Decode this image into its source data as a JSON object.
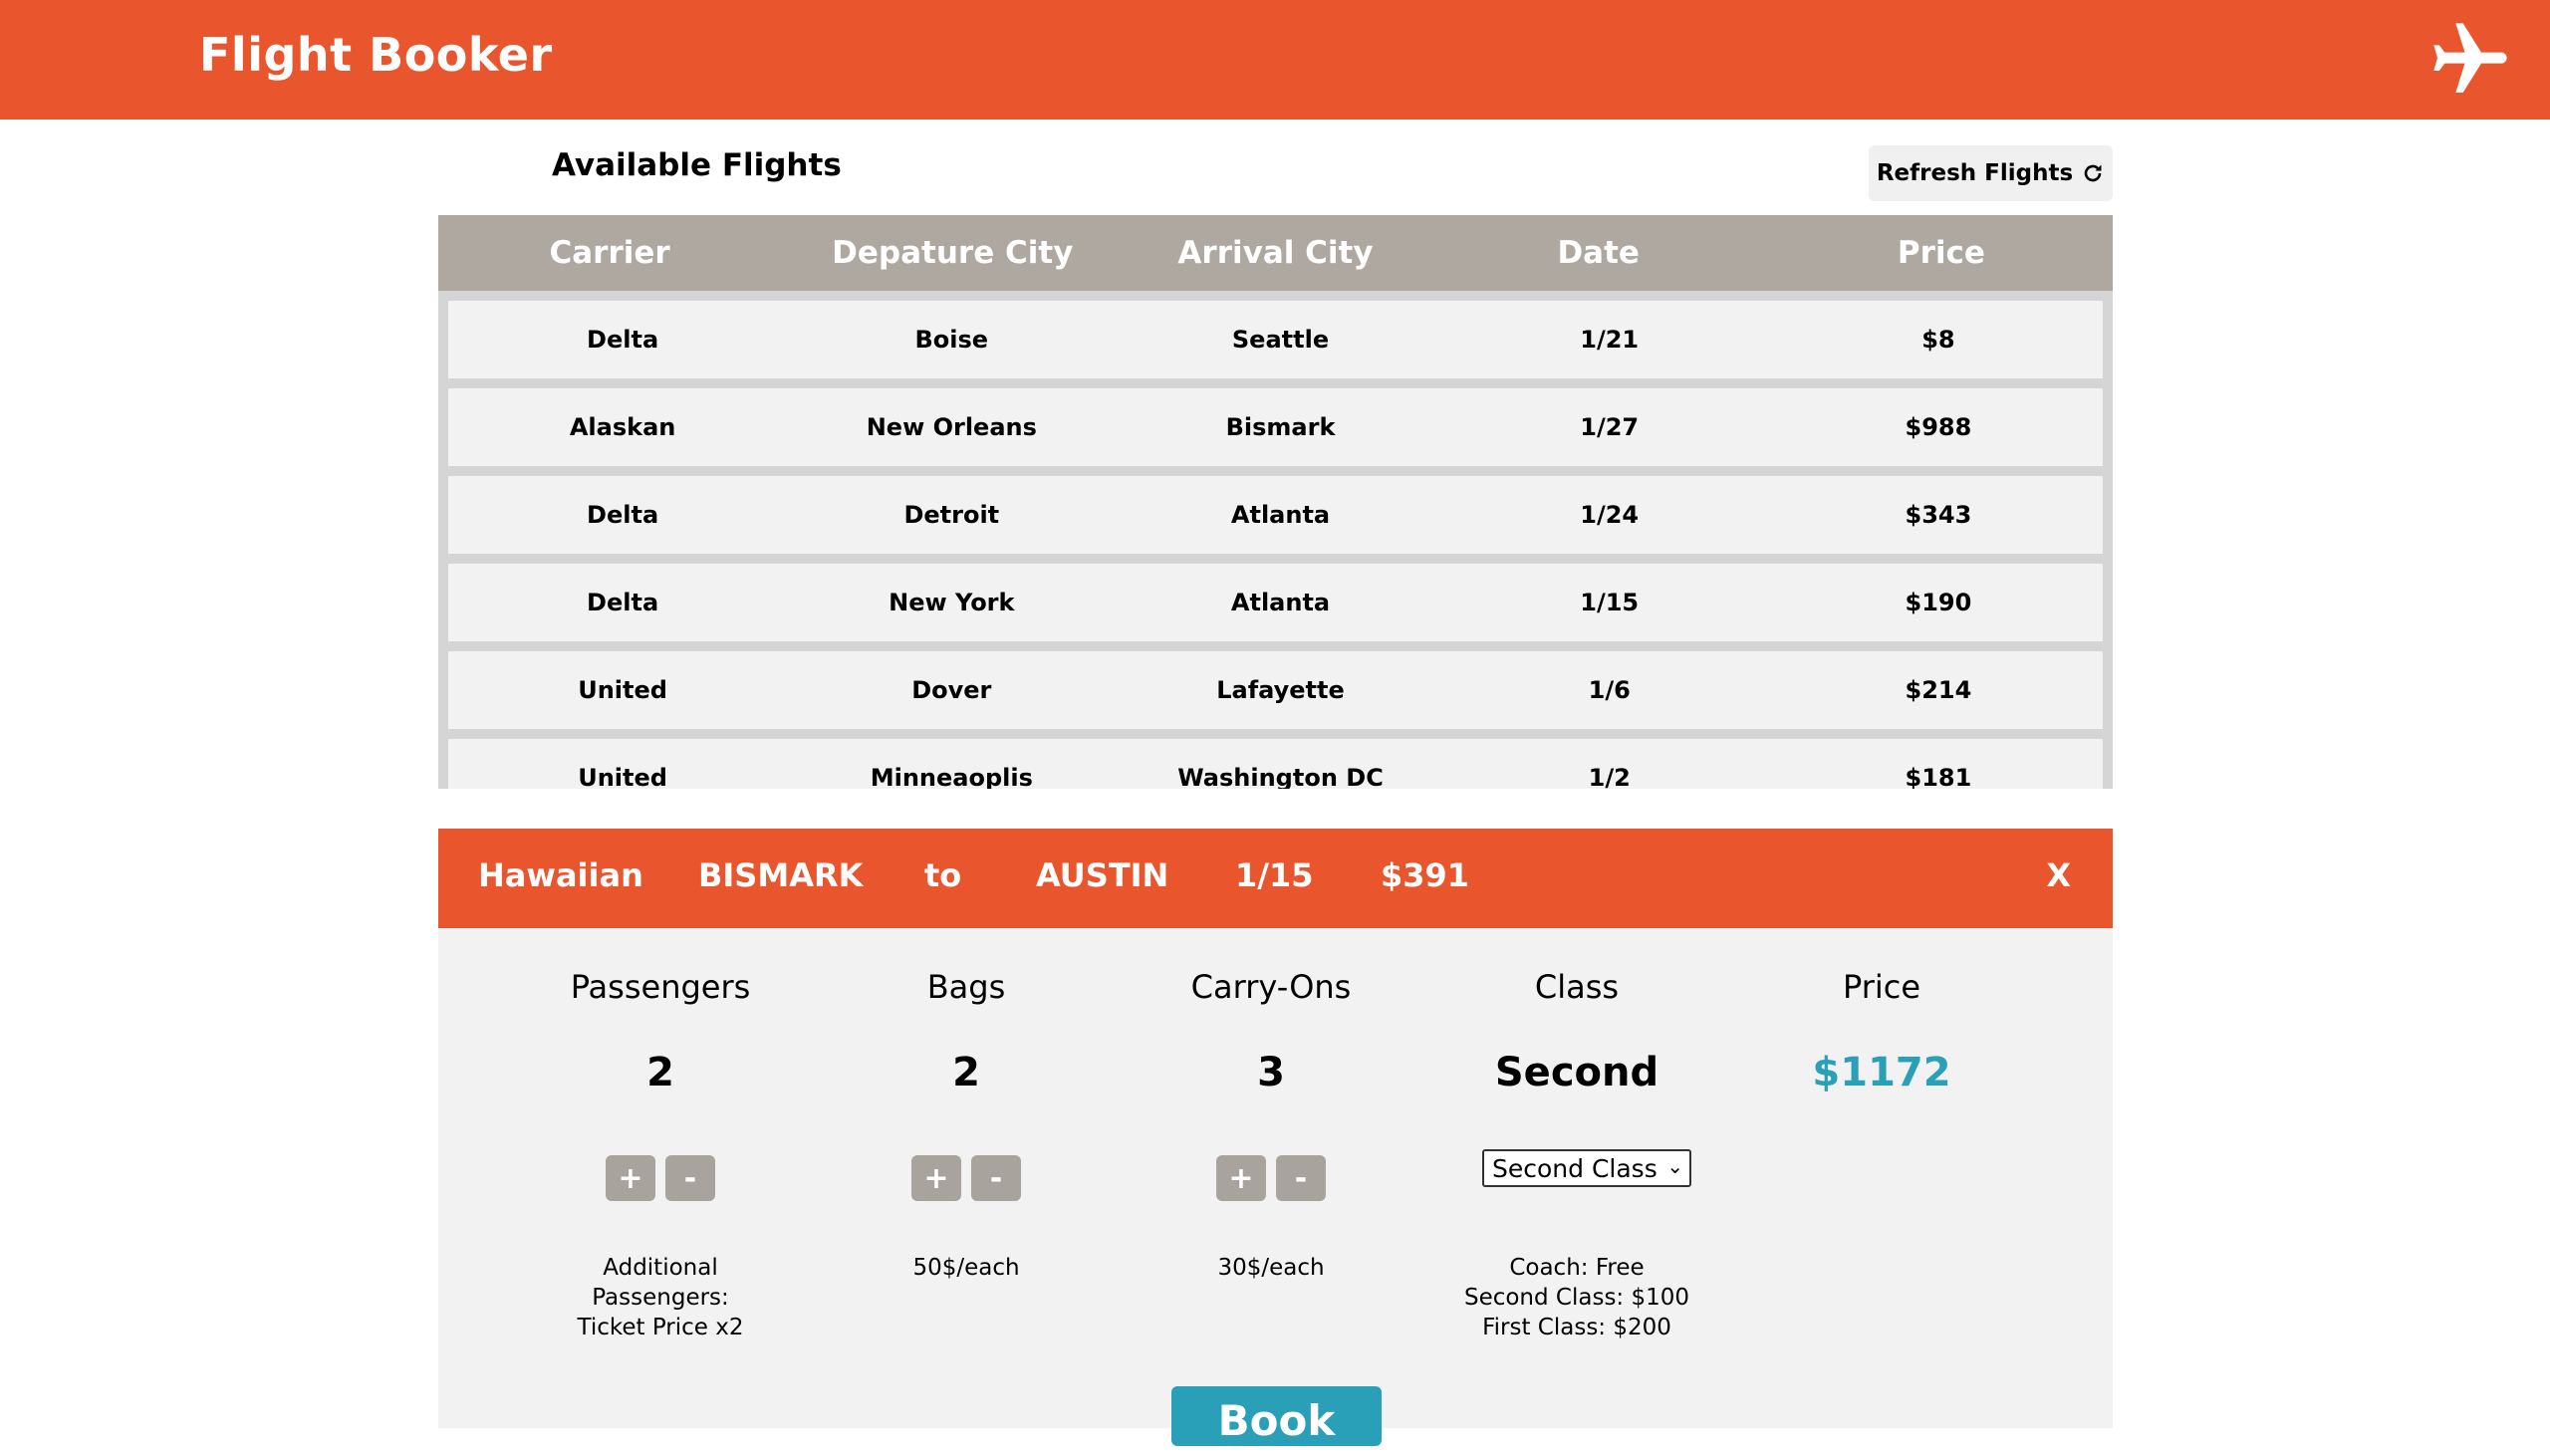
{
  "header": {
    "title": "Flight Booker",
    "icon": "airplane-icon"
  },
  "flights": {
    "title": "Available Flights",
    "refresh_label": "Refresh Flights",
    "columns": [
      "Carrier",
      "Depature City",
      "Arrival City",
      "Date",
      "Price"
    ],
    "rows": [
      [
        "Delta",
        "Boise",
        "Seattle",
        "1/21",
        "$8"
      ],
      [
        "Alaskan",
        "New Orleans",
        "Bismark",
        "1/27",
        "$988"
      ],
      [
        "Delta",
        "Detroit",
        "Atlanta",
        "1/24",
        "$343"
      ],
      [
        "Delta",
        "New York",
        "Atlanta",
        "1/15",
        "$190"
      ],
      [
        "United",
        "Dover",
        "Lafayette",
        "1/6",
        "$214"
      ],
      [
        "United",
        "Minneaoplis",
        "Washington DC",
        "1/2",
        "$181"
      ]
    ]
  },
  "selected": {
    "carrier": "Hawaiian",
    "from": "BISMARK",
    "to_word": "to",
    "to": "AUSTIN",
    "date": "1/15",
    "price": "$391",
    "close": "X"
  },
  "booking": {
    "passengers": {
      "label": "Passengers",
      "value": "2",
      "note": "Additional Passengers: Ticket Price x2"
    },
    "bags": {
      "label": "Bags",
      "value": "2",
      "note": "50$/each"
    },
    "carryons": {
      "label": "Carry-Ons",
      "value": "3",
      "note": "30$/each"
    },
    "class": {
      "label": "Class",
      "value": "Second",
      "selected_option": "Second Class",
      "note1": "Coach: Free",
      "note2": "Second Class: $100",
      "note3": "First Class: $200"
    },
    "price": {
      "label": "Price",
      "value": "$1172"
    },
    "plus": "+",
    "minus": "-",
    "book_label": "Book"
  },
  "colors": {
    "accent": "#e9552d",
    "price": "#2a9fb8",
    "table_header": "#aea8a1"
  }
}
